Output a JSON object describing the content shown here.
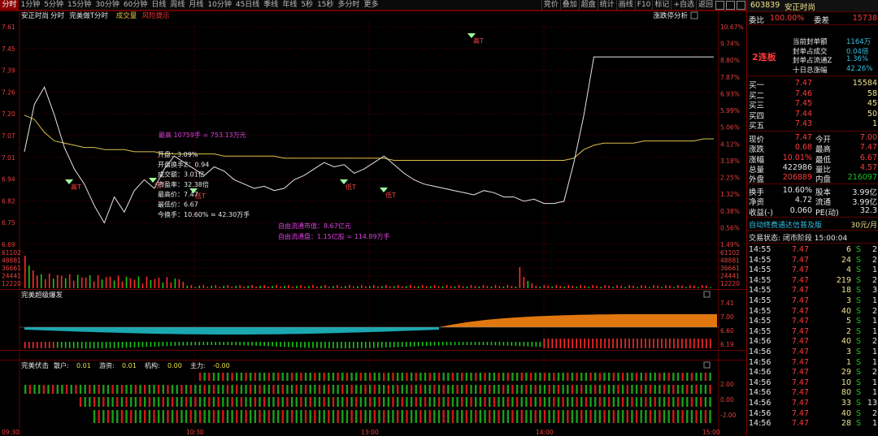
{
  "toolbar": {
    "tabs": [
      "分时",
      "1分钟",
      "5分钟",
      "15分钟",
      "30分钟",
      "60分钟",
      "日线",
      "周线",
      "月线",
      "10分钟",
      "45日线",
      "季线",
      "年线",
      "5秒",
      "15秒",
      "多分时",
      "更多"
    ],
    "right_tools": [
      "竞价",
      "叠加",
      "超盘",
      "统计",
      "画线",
      "F10",
      "标记",
      "+自选",
      "返回"
    ]
  },
  "main_chart": {
    "title": "安正时尚",
    "subtitle_items": [
      "分时",
      "完美做T分时",
      "成交量",
      "风险提示"
    ],
    "right_label": "涨跌停分析",
    "y_left": [
      "7.61",
      "7.45",
      "7.39",
      "7.26",
      "7.20",
      "7.07",
      "7.01",
      "6.94",
      "6.82",
      "6.75",
      "6.69"
    ],
    "y_right": [
      "10.67%",
      "9.74%",
      "8.80%",
      "7.87%",
      "6.93%",
      "5.99%",
      "5.06%",
      "4.12%",
      "3.18%",
      "2.25%",
      "1.32%",
      "0.38%",
      "0.56%",
      "1.49%"
    ],
    "x_labels": [
      "09:30",
      "10:30",
      "13:00",
      "14:00",
      "15:00"
    ],
    "annotations": {
      "avg_price": "最高 10759手 = 753.13万元",
      "info_lines": [
        "开盘：3.09%",
        "开盘换手Z：0.94",
        "成交额：3.01亿",
        "市盈率：32.38倍",
        "最高价：7.47",
        "最低价：6.67",
        "今换手：10.60% ≈ 42.30万手"
      ],
      "float_mv": "自由流通市值：8.67亿元",
      "float_shares": "自由流通盘：1.15亿股 = 114.89万手"
    },
    "markers": [
      "高T",
      "低T",
      "低T",
      "低T",
      "低T",
      "高T"
    ],
    "line_colors": {
      "price": "#e6e6e6",
      "avg": "#d9c24a",
      "up": "#ff2a2a",
      "down": "#17c817",
      "cyan": "#1aa7b0",
      "orange": "#e0780f"
    }
  },
  "volume_chart": {
    "y_left": [
      "61102",
      "48881",
      "36661",
      "24441",
      "12220"
    ],
    "y_right": [
      "61102",
      "48881",
      "36661",
      "24441",
      "12220"
    ]
  },
  "indicator1": {
    "title": "完美超级爆发",
    "y_right": [
      "7.41",
      "7.00",
      "6.60",
      "6.19"
    ]
  },
  "indicator2": {
    "title": "完美伏击",
    "params": [
      {
        "label": "散户:",
        "value": "0.01"
      },
      {
        "label": "游资:",
        "value": "0.01"
      },
      {
        "label": "机构:",
        "value": "0.00"
      },
      {
        "label": "主力:",
        "value": "-0.00"
      }
    ],
    "y_right": [
      "2.00",
      "0.00",
      "-2.00"
    ]
  },
  "quote": {
    "code": "603839",
    "name": "安正时尚",
    "weibi_label": "委比",
    "weibi_value": "100.00%",
    "weicha_label": "委差",
    "weicha_value": "15738",
    "limit_text": "2连板",
    "limit_info": [
      {
        "label": "当前封单额",
        "value": "1164万"
      },
      {
        "label": "封单占成交",
        "value": "0.04倍"
      },
      {
        "label": "封单占流通Z",
        "value": "1.36%"
      },
      {
        "label": "十日总涨幅",
        "value": "42.26%"
      }
    ],
    "sell": [
      {
        "label": "卖五",
        "price": "",
        "vol": ""
      },
      {
        "label": "卖四",
        "price": "",
        "vol": ""
      },
      {
        "label": "卖三",
        "price": "",
        "vol": ""
      },
      {
        "label": "卖二",
        "price": "",
        "vol": ""
      },
      {
        "label": "卖一",
        "price": "",
        "vol": ""
      }
    ],
    "buy": [
      {
        "label": "买一",
        "price": "7.47",
        "vol": "15584"
      },
      {
        "label": "买二",
        "price": "7.46",
        "vol": "58"
      },
      {
        "label": "买三",
        "price": "7.45",
        "vol": "45"
      },
      {
        "label": "买四",
        "price": "7.44",
        "vol": "50"
      },
      {
        "label": "买五",
        "price": "7.43",
        "vol": "1"
      }
    ],
    "stats": [
      {
        "l1": "现价",
        "v1": "7.47",
        "c1": "red",
        "l2": "今开",
        "v2": "7.00",
        "c2": "red"
      },
      {
        "l1": "涨跌",
        "v1": "0.68",
        "c1": "red",
        "l2": "最高",
        "v2": "7.47",
        "c2": "red"
      },
      {
        "l1": "涨幅",
        "v1": "10.01%",
        "c1": "red",
        "l2": "最低",
        "v2": "6.67",
        "c2": "red"
      },
      {
        "l1": "总量",
        "v1": "422986",
        "c1": "wht",
        "l2": "量比",
        "v2": "4.57",
        "c2": "red"
      },
      {
        "l1": "外盘",
        "v1": "206889",
        "c1": "red",
        "l2": "内盘",
        "v2": "216097",
        "c2": "green"
      }
    ],
    "stats2": [
      {
        "l1": "换手",
        "v1": "10.60%",
        "l2": "股本",
        "v2": "3.99亿"
      },
      {
        "l1": "净资",
        "v1": "4.72",
        "l2": "流通",
        "v2": "3.99亿"
      },
      {
        "l1": "收益(-)",
        "v1": "0.060",
        "l2": "PE(动)",
        "v2": "32.3"
      }
    ],
    "flow_label": "自动终费通达信普及版",
    "flow_value": "30元/月",
    "status": "交易状态: 闭市阶段 15:00:04",
    "trades": [
      {
        "t": "14:55",
        "p": "7.47",
        "v": "6",
        "s": "S",
        "n": "2"
      },
      {
        "t": "14:55",
        "p": "7.47",
        "v": "24",
        "s": "S",
        "n": "2"
      },
      {
        "t": "14:55",
        "p": "7.47",
        "v": "4",
        "s": "S",
        "n": "1"
      },
      {
        "t": "14:55",
        "p": "7.47",
        "v": "219",
        "s": "S",
        "n": "2"
      },
      {
        "t": "14:55",
        "p": "7.47",
        "v": "18",
        "s": "S",
        "n": "3"
      },
      {
        "t": "14:55",
        "p": "7.47",
        "v": "3",
        "s": "S",
        "n": "1"
      },
      {
        "t": "14:55",
        "p": "7.47",
        "v": "40",
        "s": "S",
        "n": "2"
      },
      {
        "t": "14:55",
        "p": "7.47",
        "v": "5",
        "s": "S",
        "n": "1"
      },
      {
        "t": "14:55",
        "p": "7.47",
        "v": "2",
        "s": "S",
        "n": "1"
      },
      {
        "t": "14:56",
        "p": "7.47",
        "v": "40",
        "s": "S",
        "n": "2"
      },
      {
        "t": "14:56",
        "p": "7.47",
        "v": "3",
        "s": "S",
        "n": "1"
      },
      {
        "t": "14:56",
        "p": "7.47",
        "v": "1",
        "s": "S",
        "n": "1"
      },
      {
        "t": "14:56",
        "p": "7.47",
        "v": "29",
        "s": "S",
        "n": "2"
      },
      {
        "t": "14:56",
        "p": "7.47",
        "v": "10",
        "s": "S",
        "n": "1"
      },
      {
        "t": "14:56",
        "p": "7.47",
        "v": "80",
        "s": "S",
        "n": "1"
      },
      {
        "t": "14:56",
        "p": "7.47",
        "v": "33",
        "s": "S",
        "n": "13"
      },
      {
        "t": "14:56",
        "p": "7.47",
        "v": "40",
        "s": "S",
        "n": "2"
      },
      {
        "t": "14:56",
        "p": "7.47",
        "v": "28",
        "s": "S",
        "n": "1"
      }
    ]
  }
}
